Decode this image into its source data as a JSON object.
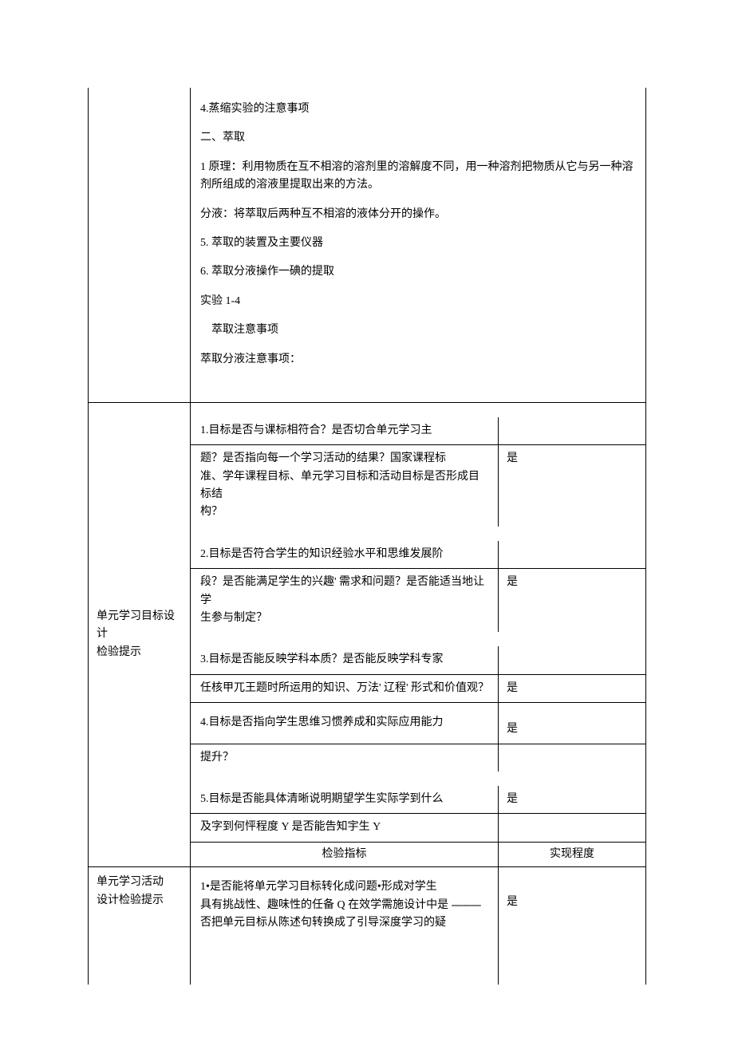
{
  "top": {
    "p1": "4.蒸缩实验的注意事项",
    "p2": "二、萃取",
    "p3": "1 原理：利用物质在互不相溶的溶剂里的溶解度不同，用一种溶剂把物质从它与另一种溶剂所组成的溶液里提取出来的方法。",
    "p4": "分液：将萃取后两种互不相溶的液体分开的操作。",
    "p5": "5. 萃取的装置及主要仪器",
    "p6": "6. 萃取分液操作一碘的提取",
    "p7": "实验 1-4",
    "p8": "萃取注意事项",
    "p9": "萃取分液注意事项：",
    "label": ""
  },
  "sec1": {
    "label1": "单元学习目标设计",
    "label2": "检验提示",
    "q1a": "1.目标是否与课标相符合？是否切合单元学习主",
    "q1b": "题？是否指向每一个学习活动的结果？国家课程标",
    "q1c": "准、学年课程目标、单元学习目标和活动目标是否形成目标结",
    "q1d": "构？",
    "a1": "是",
    "q2a": "2.目标是否符合学生的知识经验水平和思维发展阶",
    "q2b": "段？是否能满足学生的兴趣' 需求和问题？是否能适当地让学",
    "q2c": "生参与制定？",
    "a2": "是",
    "q3a": "3.目标是否能反映学科本质？是否能反映学科专家",
    "q3b": "任核甲兀王题时所运用的知识、万法' 辽程' 形式和价值观？",
    "a3": "是",
    "q4a": "4.目标是否指向学生思维习惯养成和实际应用能力",
    "q4b": "提升？",
    "a4": "是",
    "q5a": "5.目标是否能具体清晰说明期望学生实际学到什么",
    "q5b": "及字到何怦程度 Y 是否能告知宇生 Y",
    "a5": "是",
    "hLeft": "检验指标",
    "hRight": "实现程度"
  },
  "sec2": {
    "label1": "单元学习活动",
    "label2": "设计检验提示",
    "q1a": "1•是否能将单元学习目标转化成问题•形成对学生",
    "q1b_pre": "具有挑战性、趣味性的任备 Q 在效学需施设计中是 ",
    "q1b_dash": "----------",
    "q1c": "否把单元目标从陈述句转换成了引导深度学习的疑",
    "a1": "是"
  }
}
